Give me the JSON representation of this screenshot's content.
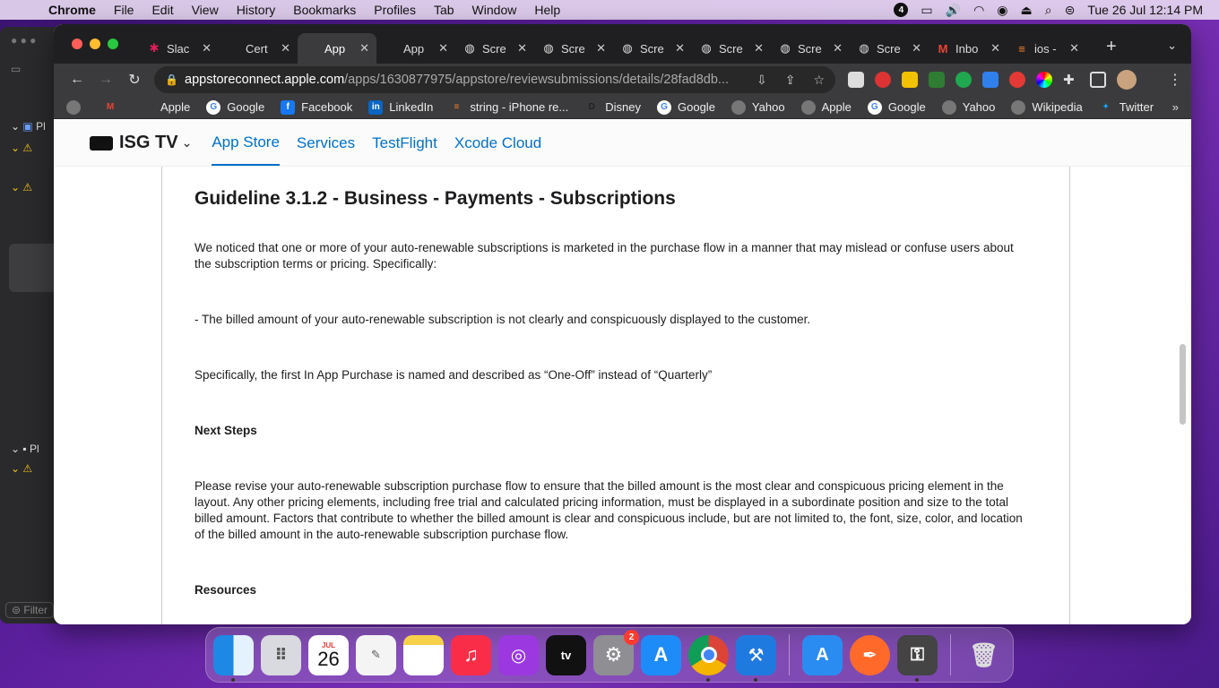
{
  "menubar": {
    "app": "Chrome",
    "items": [
      "File",
      "Edit",
      "View",
      "History",
      "Bookmarks",
      "Profiles",
      "Tab",
      "Window",
      "Help"
    ],
    "notification_count": "4",
    "datetime": "Tue 26 Jul  12:14 PM"
  },
  "xcode": {
    "row1": "Pl",
    "row2": "Pl",
    "filter": "Filter"
  },
  "tabs": [
    {
      "label": "Slac",
      "icon": "slack-icon"
    },
    {
      "label": "Cert",
      "icon": "apple-icon"
    },
    {
      "label": "App",
      "icon": "apple-icon"
    },
    {
      "label": "App",
      "icon": "apple-icon"
    },
    {
      "label": "Scre",
      "icon": "globe-icon"
    },
    {
      "label": "Scre",
      "icon": "globe-icon"
    },
    {
      "label": "Scre",
      "icon": "globe-icon"
    },
    {
      "label": "Scre",
      "icon": "globe-icon"
    },
    {
      "label": "Scre",
      "icon": "globe-icon"
    },
    {
      "label": "Scre",
      "icon": "globe-icon"
    },
    {
      "label": "Inbo",
      "icon": "gmail-icon"
    },
    {
      "label": "ios -",
      "icon": "stackoverflow-icon"
    }
  ],
  "address": {
    "host": "appstoreconnect.apple.com",
    "path": "/apps/1630877975/appstore/reviewsubmissions/details/28fad8db..."
  },
  "bookmarks": [
    {
      "label": "",
      "icon": "globe-icon"
    },
    {
      "label": "",
      "icon": "gmail-icon"
    },
    {
      "label": "Apple",
      "icon": "apple-icon"
    },
    {
      "label": "Google",
      "icon": "google-icon"
    },
    {
      "label": "Facebook",
      "icon": "facebook-icon"
    },
    {
      "label": "LinkedIn",
      "icon": "linkedin-icon"
    },
    {
      "label": "string - iPhone re...",
      "icon": "stackoverflow-icon"
    },
    {
      "label": "Disney",
      "icon": "disney-icon"
    },
    {
      "label": "Google",
      "icon": "google-icon"
    },
    {
      "label": "Yahoo",
      "icon": "globe-icon"
    },
    {
      "label": "Apple",
      "icon": "globe-icon"
    },
    {
      "label": "Google",
      "icon": "google-icon"
    },
    {
      "label": "Yahoo",
      "icon": "globe-icon"
    },
    {
      "label": "Wikipedia",
      "icon": "globe-icon"
    },
    {
      "label": "Twitter",
      "icon": "twitter-icon"
    }
  ],
  "appnav": {
    "brand": "ISG TV",
    "links": [
      "App Store",
      "Services",
      "TestFlight",
      "Xcode Cloud"
    ]
  },
  "content": {
    "title": "Guideline 3.1.2 - Business - Payments - Subscriptions",
    "p1": "We noticed that one or more of your auto-renewable subscriptions is marketed in the purchase flow in a manner that may mislead or confuse users about the subscription terms or pricing. Specifically:",
    "p2": "- The billed amount of your auto-renewable subscription is not clearly and conspicuously displayed to the customer.",
    "p3": "Specifically, the first In App Purchase is named and described as “One-Off” instead of “Quarterly”",
    "next_steps": "Next Steps",
    "p4": "Please revise your auto-renewable subscription purchase flow to ensure that the billed amount is the most clear and conspicuous pricing element in the layout. Any other pricing elements, including free trial and calculated pricing information, must be displayed in a subordinate position and size to the total billed amount. Factors that contribute to whether the billed amount is clear and conspicuous include, but are not limited to, the font, size, color, and location of the billed amount in the auto-renewable subscription purchase flow.",
    "resources": "Resources"
  },
  "dock": {
    "calendar_month": "JUL",
    "calendar_day": "26",
    "settings_badge": "2",
    "tv_label": "tv"
  }
}
